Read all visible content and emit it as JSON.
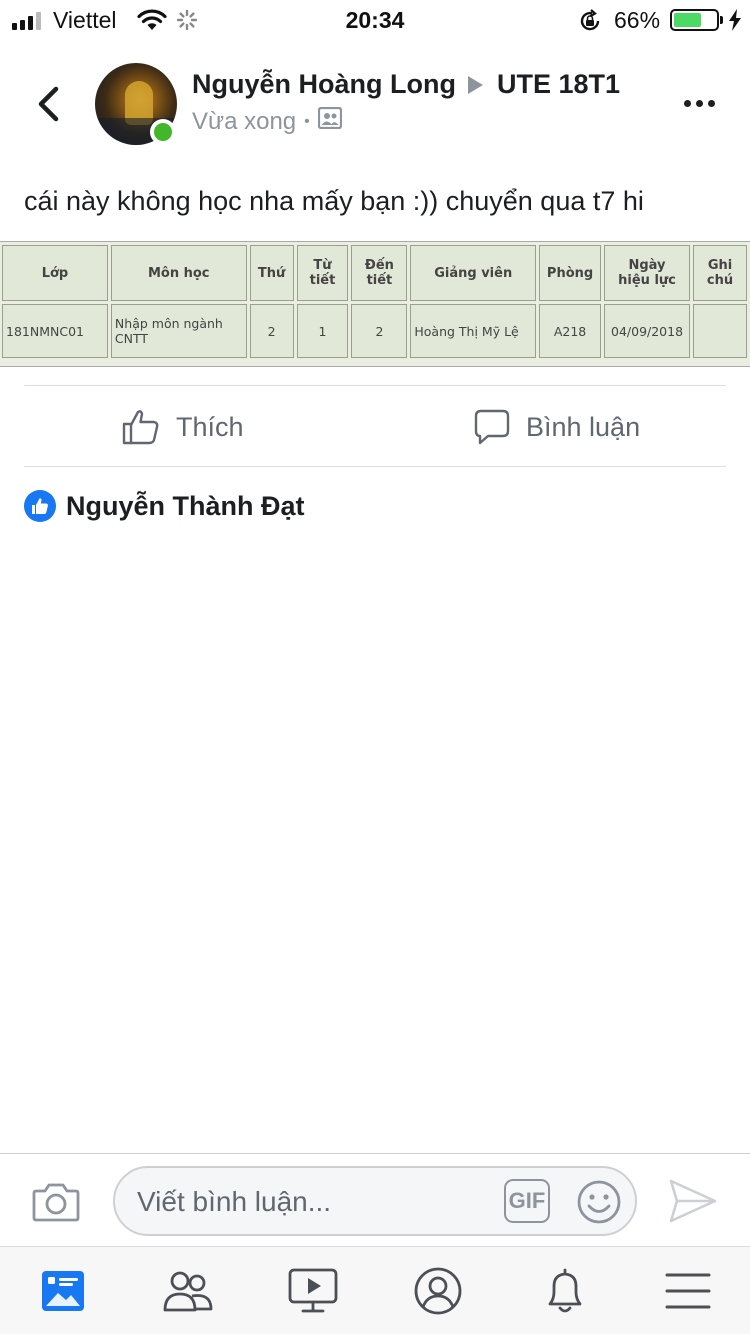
{
  "status_bar": {
    "carrier": "Viettel",
    "time": "20:34",
    "battery_percent": "66%",
    "battery_level": 0.66,
    "icons": [
      "signal-icon",
      "wifi-icon",
      "loading-spinner-icon",
      "rotation-lock-icon",
      "battery-icon",
      "charging-icon"
    ]
  },
  "post": {
    "author": "Nguyễn Hoàng Long",
    "group": "UTE 18T1",
    "time": "Vừa xong",
    "privacy_icon": "group-privacy-icon",
    "text": "cái này không học nha mấy bạn :)) chuyển qua t7 hi"
  },
  "schedule_table": {
    "headers": [
      {
        "line1": "Lớp",
        "line2": ""
      },
      {
        "line1": "Môn học",
        "line2": ""
      },
      {
        "line1": "Thứ",
        "line2": ""
      },
      {
        "line1": "Từ",
        "line2": "tiết"
      },
      {
        "line1": "Đến",
        "line2": "tiết"
      },
      {
        "line1": "Giảng viên",
        "line2": ""
      },
      {
        "line1": "Phòng",
        "line2": ""
      },
      {
        "line1": "Ngày",
        "line2": "hiệu lực"
      },
      {
        "line1": "Ghi",
        "line2": "chú"
      }
    ],
    "row": {
      "lop": "181NMNC01",
      "mon_hoc_1": "Nhập môn ngành",
      "mon_hoc_2": "CNTT",
      "thu": "2",
      "tu_tiet": "1",
      "den_tiet": "2",
      "giang_vien": "Hoàng Thị Mỹ Lệ",
      "phong": "A218",
      "ngay_hieu_luc": "04/09/2018",
      "ghi_chu": ""
    }
  },
  "actions": {
    "like_label": "Thích",
    "comment_label": "Bình luận"
  },
  "reactions": {
    "liked_by": "Nguyễn Thành Đạt"
  },
  "comment_bar": {
    "placeholder": "Viết bình luận...",
    "gif_label": "GIF"
  },
  "bottom_nav": {
    "items": [
      "news-feed-icon",
      "friends-icon",
      "watch-icon",
      "profile-icon",
      "notifications-icon",
      "menu-icon"
    ],
    "active_color": "#1877f2"
  },
  "colors": {
    "brand": "#1877f2",
    "online": "#42b72a",
    "battery": "#4cd964"
  }
}
